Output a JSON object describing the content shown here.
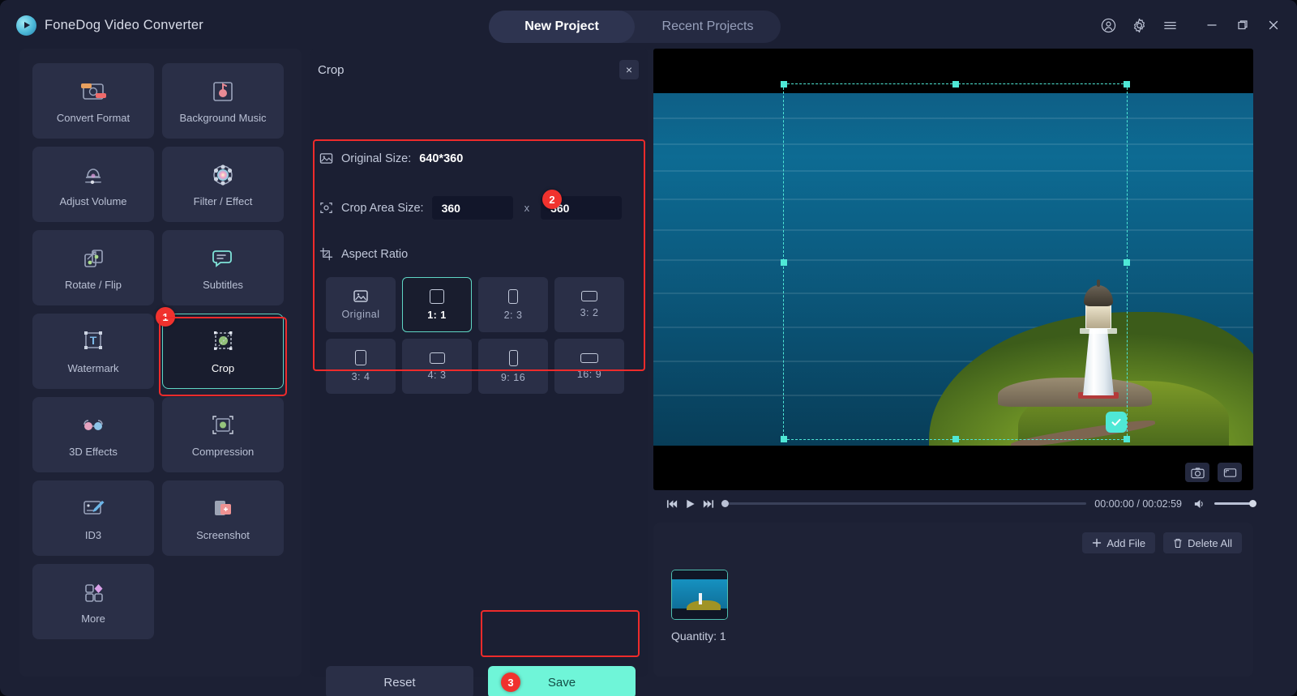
{
  "app": {
    "title": "FoneDog Video Converter",
    "logo_icon": "play-circle-logo"
  },
  "header": {
    "tabs": [
      {
        "label": "New Project",
        "active": true
      },
      {
        "label": "Recent Projects",
        "active": false
      }
    ],
    "icons": [
      {
        "name": "account-icon"
      },
      {
        "name": "gear-icon"
      },
      {
        "name": "menu-icon"
      },
      {
        "name": "minimize-icon"
      },
      {
        "name": "maximize-icon"
      },
      {
        "name": "close-icon"
      }
    ]
  },
  "sidebar": {
    "tools": [
      {
        "label": "Convert Format",
        "icon": "convert-format-icon",
        "selected": false
      },
      {
        "label": "Background Music",
        "icon": "background-music-icon",
        "selected": false
      },
      {
        "label": "Adjust Volume",
        "icon": "adjust-volume-icon",
        "selected": false
      },
      {
        "label": "Filter / Effect",
        "icon": "filter-effect-icon",
        "selected": false
      },
      {
        "label": "Rotate / Flip",
        "icon": "rotate-flip-icon",
        "selected": false
      },
      {
        "label": "Subtitles",
        "icon": "subtitles-icon",
        "selected": false
      },
      {
        "label": "Watermark",
        "icon": "watermark-icon",
        "selected": false
      },
      {
        "label": "Crop",
        "icon": "crop-icon",
        "selected": true
      },
      {
        "label": "3D Effects",
        "icon": "3d-effects-icon",
        "selected": false
      },
      {
        "label": "Compression",
        "icon": "compression-icon",
        "selected": false
      },
      {
        "label": "ID3",
        "icon": "id3-icon",
        "selected": false
      },
      {
        "label": "Screenshot",
        "icon": "screenshot-icon",
        "selected": false
      },
      {
        "label": "More",
        "icon": "more-icon",
        "selected": false
      }
    ]
  },
  "crop_panel": {
    "title": "Crop",
    "close_label": "×",
    "original_size_label": "Original Size:",
    "original_size_value": "640*360",
    "crop_area_label": "Crop Area Size:",
    "crop_width": "360",
    "crop_height": "360",
    "dimension_separator": "x",
    "aspect_ratio_label": "Aspect Ratio",
    "aspect_ratios": [
      {
        "label": "Original",
        "shape": "image",
        "active": false
      },
      {
        "label": "1: 1",
        "shape": "square",
        "active": true
      },
      {
        "label": "2: 3",
        "shape": "portrait",
        "active": false
      },
      {
        "label": "3: 2",
        "shape": "landscape",
        "active": false
      },
      {
        "label": "3: 4",
        "shape": "portrait",
        "active": false
      },
      {
        "label": "4: 3",
        "shape": "landscape",
        "active": false
      },
      {
        "label": "9: 16",
        "shape": "tall",
        "active": false
      },
      {
        "label": "16: 9",
        "shape": "wide",
        "active": false
      }
    ],
    "reset_label": "Reset",
    "save_label": "Save"
  },
  "annotations": [
    {
      "number": "1",
      "target": "crop-tool"
    },
    {
      "number": "2",
      "target": "aspect-ratio-section"
    },
    {
      "number": "3",
      "target": "save-button"
    }
  ],
  "preview": {
    "confirm_icon": "check-icon",
    "screenshot_icon": "camera-icon",
    "fullscreen_icon": "expand-icon"
  },
  "player": {
    "prev_icon": "previous-frame-icon",
    "play_icon": "play-icon",
    "next_icon": "next-frame-icon",
    "current_time": "00:00:00",
    "total_time": "00:02:59",
    "time_display": "00:00:00 / 00:02:59",
    "volume_icon": "volume-icon"
  },
  "file_list": {
    "add_file_label": "Add File",
    "add_file_icon": "plus-icon",
    "delete_all_label": "Delete All",
    "delete_all_icon": "trash-icon",
    "quantity_label": "Quantity: 1"
  },
  "colors": {
    "accent": "#6ff5d8",
    "annotation": "#ee2b2b",
    "badge": "#f0322e",
    "panel_bg": "#1b1f33",
    "tile_bg": "#2a2f47"
  }
}
